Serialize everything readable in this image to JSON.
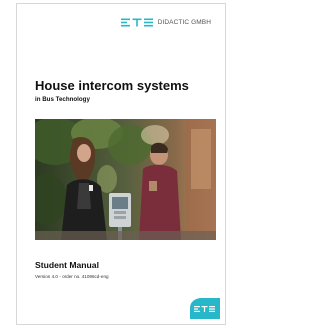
{
  "brand": {
    "name": "DIDACTIC GMBH",
    "logo_text": "ETS",
    "logo_icon": "ets-logo-icon",
    "accent_color": "#28b7c8"
  },
  "document": {
    "title": "House intercom systems",
    "subtitle": "in Bus Technology",
    "cover_image": "cover-photo-intercom-scene",
    "manual_type": "Student Manual",
    "version_line": "Version 4.0 - order no. 41096cd-eng"
  },
  "footer": {
    "corner_logo_icon": "ets-corner-logo-icon"
  }
}
